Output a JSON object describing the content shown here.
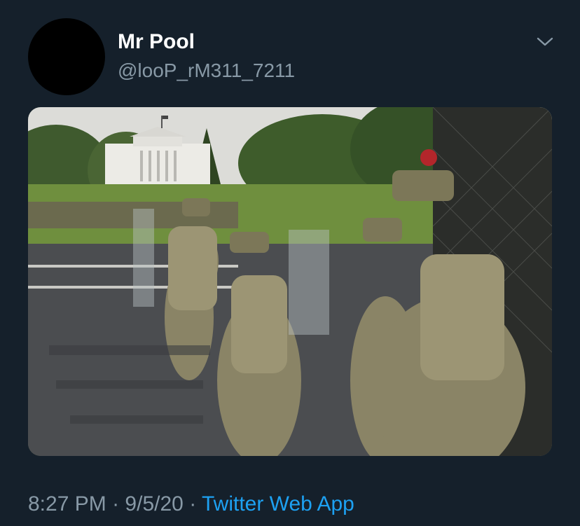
{
  "tweet": {
    "author_name": "Mr Pool",
    "author_handle": "@looP_rM311_7211",
    "time": "8:27 PM",
    "date": "9/5/20",
    "separator": "·",
    "source": "Twitter Web App",
    "menu_icon": "chevron-down-icon",
    "media": {
      "type": "photo",
      "alt_visible": false
    }
  },
  "colors": {
    "background": "#15202b",
    "primary_text": "#ffffff",
    "secondary_text": "#8899a6",
    "link": "#1da1f2"
  }
}
